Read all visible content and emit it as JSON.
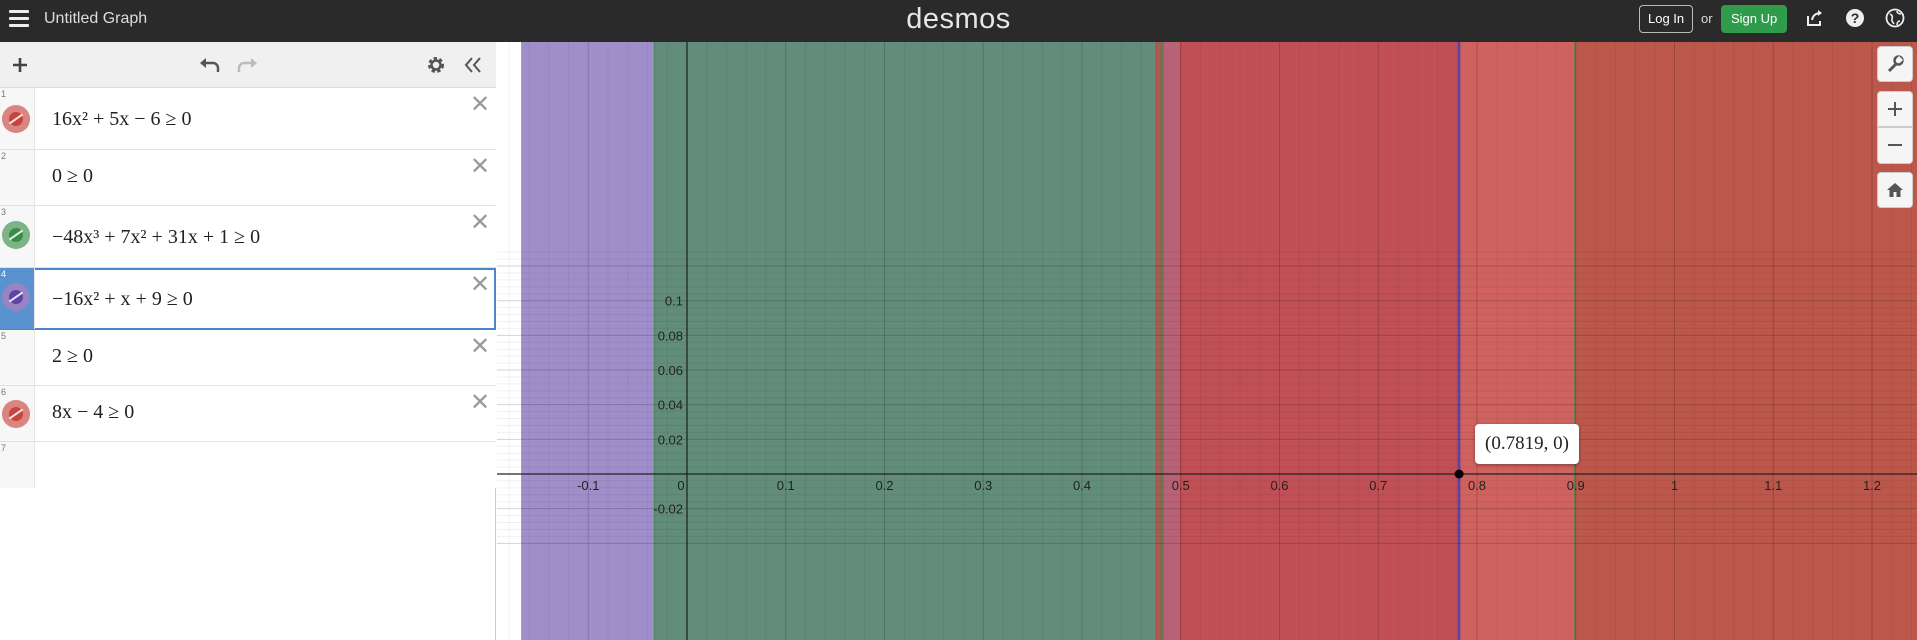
{
  "header": {
    "title": "Untitled Graph",
    "brand": "desmos",
    "login_label": "Log In",
    "or_label": "or",
    "signup_label": "Sign Up",
    "share_icon": "share-icon",
    "help_icon": "help-icon",
    "language_icon": "globe-icon"
  },
  "toolbar": {
    "add_icon": "plus-icon",
    "undo_icon": "undo-icon",
    "redo_icon": "redo-icon",
    "settings_icon": "gear-icon",
    "collapse_icon": "double-chevron-left-icon"
  },
  "expressions": [
    {
      "index": "1",
      "latex": "16x² + 5x − 6 ≥ 0",
      "color": "#c74440",
      "selected": false
    },
    {
      "index": "2",
      "latex": "0 ≥ 0",
      "color": null,
      "selected": false
    },
    {
      "index": "3",
      "latex": "−48x³ + 7x² + 31x + 1 ≥ 0",
      "color": "#388c46",
      "selected": false
    },
    {
      "index": "4",
      "latex": "−16x² + x + 9 ≥ 0",
      "color": "#6042a6",
      "selected": true
    },
    {
      "index": "5",
      "latex": "2 ≥ 0",
      "color": null,
      "selected": false
    },
    {
      "index": "6",
      "latex": "8x − 4 ≥ 0",
      "color": "#c74440",
      "selected": false
    },
    {
      "index": "7",
      "latex": "",
      "color": null,
      "selected": false
    }
  ],
  "graph": {
    "x_ticks": [
      "-0.1",
      "0",
      "0.1",
      "0.2",
      "0.3",
      "0.4",
      "0.5",
      "0.6",
      "0.7",
      "0.8",
      "0.9",
      "1",
      "1.1",
      "1.2"
    ],
    "y_ticks": [
      "0.1",
      "0.08",
      "0.06",
      "0.04",
      "0.02",
      "-0.02"
    ],
    "tooltip": "(0.7819, 0)",
    "point": {
      "x": 0.7819,
      "y": 0
    },
    "regions": [
      {
        "name": "purple",
        "from": -0.168,
        "to": 0.7819,
        "color": "#6042a6"
      },
      {
        "name": "green",
        "from": -0.033,
        "to": 0.482,
        "color": "#388c46"
      },
      {
        "name": "green",
        "from": 0.899,
        "to": 1.3,
        "color": "#388c46"
      },
      {
        "name": "red-quadratic",
        "from": 0.475,
        "to": 1.3,
        "color": "#c74440"
      },
      {
        "name": "red-linear",
        "from": 0.5,
        "to": 1.3,
        "color": "#c74440"
      }
    ],
    "zoom_in_icon": "plus-icon",
    "zoom_out_icon": "minus-icon",
    "home_icon": "home-icon",
    "wrench_icon": "wrench-icon"
  }
}
